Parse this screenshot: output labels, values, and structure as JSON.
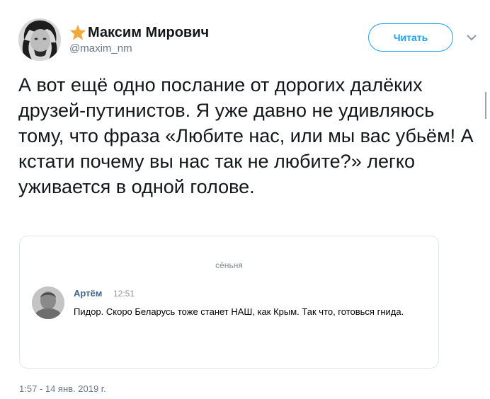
{
  "author": {
    "name": "Максим Мирович",
    "handle": "@maxim_nm",
    "badge_icon": "star-icon",
    "badge_color": "#f2a93b"
  },
  "follow_button": {
    "label": "Читать"
  },
  "menu_icon": "chevron-down-icon",
  "tweet": {
    "text": "А вот ещё одно послание от дорогих далёких друзей-путинистов. Я уже давно не удивляюсь тому, что фраза «Любите нас, или мы вас убьём! А кстати почему вы нас так не любите?» легко уживается в одной голове.",
    "timestamp": "1:57 - 14 янв. 2019 г."
  },
  "screenshot_card": {
    "date_separator": "сёньня",
    "message": {
      "author": "Артём",
      "time": "12:51",
      "text": "Пидор. Скоро Беларусь тоже станет НАШ, как Крым. Так что, готовься гнида."
    }
  },
  "colors": {
    "accent": "#1da1f2",
    "text": "#14171a",
    "muted": "#657786",
    "vk_author": "#42648b"
  }
}
